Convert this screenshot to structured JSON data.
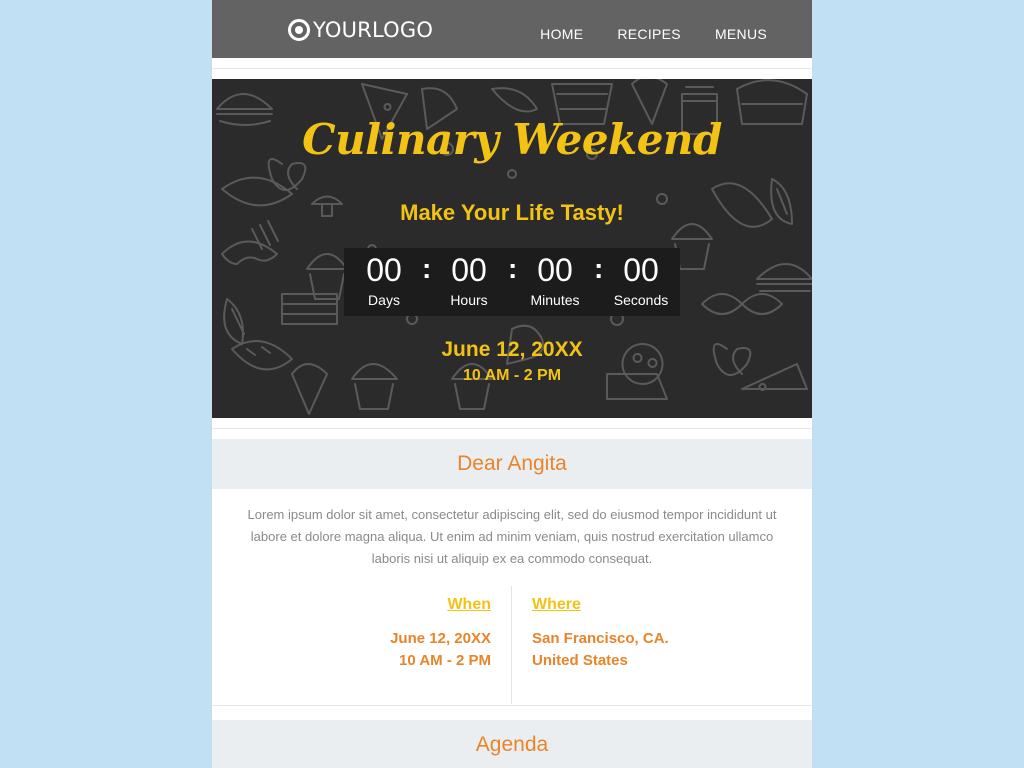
{
  "header": {
    "logo_text": "YOURLOGO",
    "nav": [
      {
        "label": "HOME"
      },
      {
        "label": "RECIPES"
      },
      {
        "label": "MENUS"
      }
    ]
  },
  "hero": {
    "title": "Culinary Weekend",
    "tagline": "Make Your Life Tasty!",
    "countdown": {
      "days": {
        "value": "00",
        "label": "Days"
      },
      "hours": {
        "value": "00",
        "label": "Hours"
      },
      "minutes": {
        "value": "00",
        "label": "Minutes"
      },
      "seconds": {
        "value": "00",
        "label": "Seconds"
      },
      "separator": ":"
    },
    "date": "June 12, 20XX",
    "time": "10 AM -  2 PM"
  },
  "greeting": "Dear Angita",
  "body_text": "Lorem ipsum dolor sit amet, consectetur adipiscing elit, sed do eiusmod tempor incididunt ut labore et dolore magna aliqua. Ut enim ad minim veniam, quis nostrud exercitation ullamco laboris nisi ut aliquip ex ea commodo consequat.",
  "when": {
    "title": "When",
    "line1": "June 12, 20XX",
    "line2": "10 AM -  2 PM"
  },
  "where": {
    "title": "Where",
    "line1": "San Francisco, CA.",
    "line2": "United States"
  },
  "agenda_title": "Agenda",
  "colors": {
    "page_bg": "#c1e0f4",
    "header_bg": "#636364",
    "accent_yellow": "#f2c314",
    "accent_orange": "#e9842b",
    "hero_bg": "#2b2b2b"
  }
}
